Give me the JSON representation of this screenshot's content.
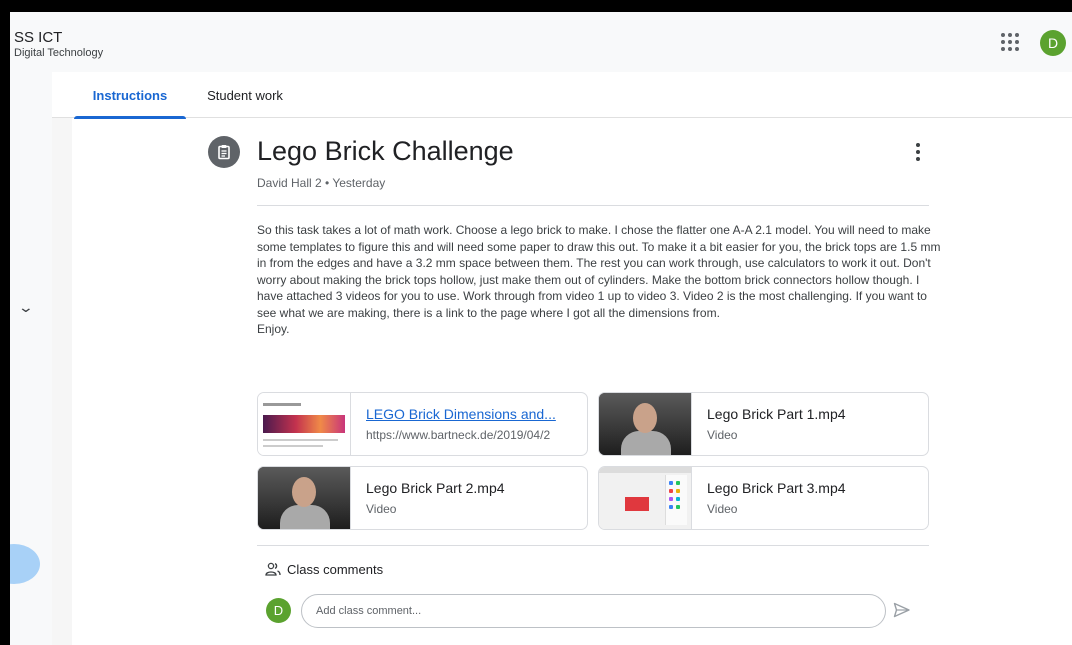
{
  "header": {
    "course_name": "SS ICT",
    "course_section": "Digital Technology",
    "user_initial": "D",
    "apps_icon": "apps-grid-icon",
    "avatar_color": "#5ba22f"
  },
  "tabs": [
    {
      "label": "Instructions",
      "active": true
    },
    {
      "label": "Student work",
      "active": false
    }
  ],
  "assignment": {
    "icon": "assignment-icon",
    "title": "Lego Brick Challenge",
    "meta": "David Hall 2 • Yesterday",
    "description": "So this task takes a lot of math work. Choose a lego brick to make. I chose the flatter one A-A 2.1 model. You will need to make some templates to figure this and will need some paper to draw this out. To make it a bit easier for you, the brick tops are 1.5 mm in from the edges and have a 3.2 mm space between them. The rest you can work through, use calculators to work it out. Don't worry about making the brick tops hollow, just make them out of cylinders. Make the bottom brick connectors hollow though. I have attached 3 videos for you to use. Work through from video 1 up to video 3. Video 2 is the most challenging. If you want to see what we are making, there is a link to the page where I got all the dimensions from.\nEnjoy."
  },
  "attachments": [
    {
      "title": "LEGO Brick Dimensions and...",
      "subtitle": "https://www.bartneck.de/2019/04/2",
      "kind": "link"
    },
    {
      "title": "Lego Brick Part 1.mp4",
      "subtitle": "Video",
      "kind": "video"
    },
    {
      "title": "Lego Brick Part 2.mp4",
      "subtitle": "Video",
      "kind": "video"
    },
    {
      "title": "Lego Brick Part 3.mp4",
      "subtitle": "Video",
      "kind": "video"
    }
  ],
  "comments": {
    "label": "Class comments",
    "placeholder": "Add class comment...",
    "user_initial": "D"
  },
  "colors": {
    "accent": "#1967d2",
    "avatar": "#5ba22f"
  }
}
